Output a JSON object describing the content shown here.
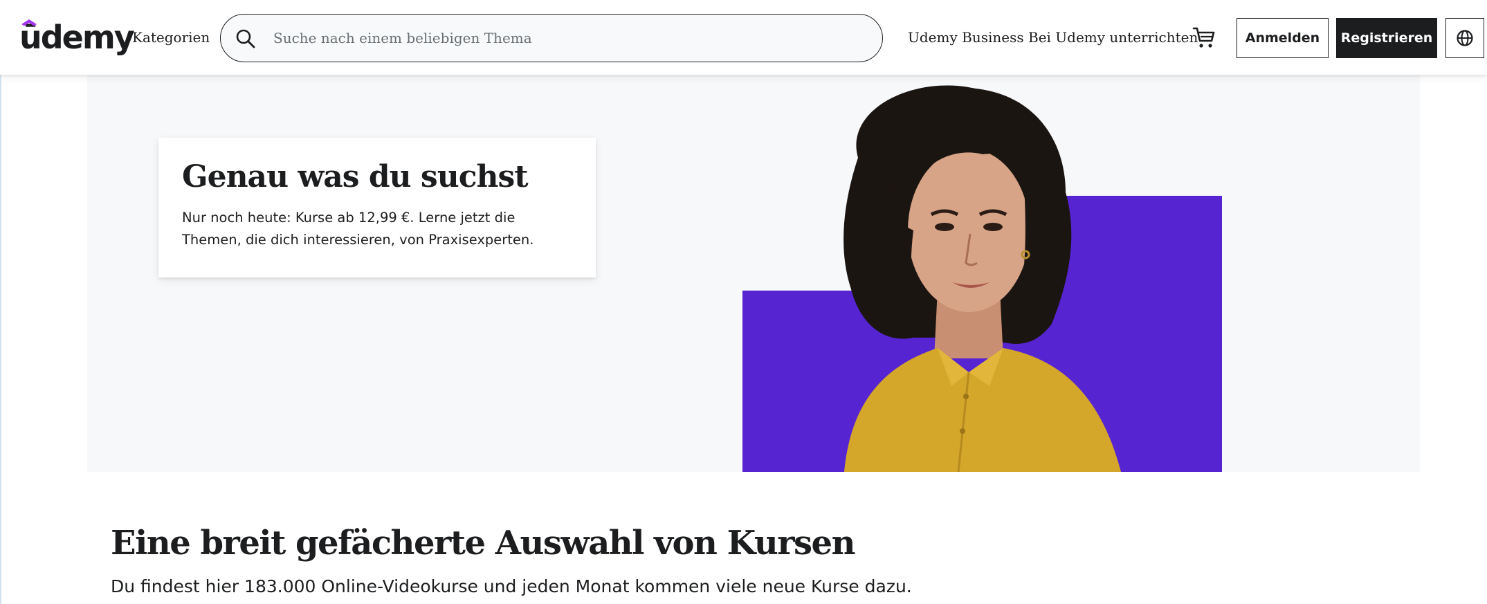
{
  "header": {
    "logo_text": "ūdemy",
    "categories_label": "Kategorien",
    "search": {
      "placeholder": "Suche nach einem beliebigen Thema",
      "value": ""
    },
    "business_label": "Udemy Business",
    "teach_label": "Bei Udemy unterrichten",
    "cart_icon": "cart-icon",
    "login_label": "Anmelden",
    "register_label": "Registrieren",
    "language_icon": "globe-icon"
  },
  "hero": {
    "title": "Genau was du suchst",
    "text": "Nur noch heute: Kurse ab 12,99 €. Lerne jetzt die Themen, die dich interessieren, von Praxisexperten."
  },
  "section": {
    "title": "Eine breit gefächerte Auswahl von Kursen",
    "text": "Du findest hier 183.000 Online-Videokurse und jeden Monat kommen viele neue Kurse dazu."
  },
  "colors": {
    "brand_purple": "#5624d0",
    "logo_cap": "#a435f0",
    "text_dark": "#1c1d1f",
    "hero_bg": "#f7f8fa",
    "shirt_yellow": "#d4a62a"
  }
}
